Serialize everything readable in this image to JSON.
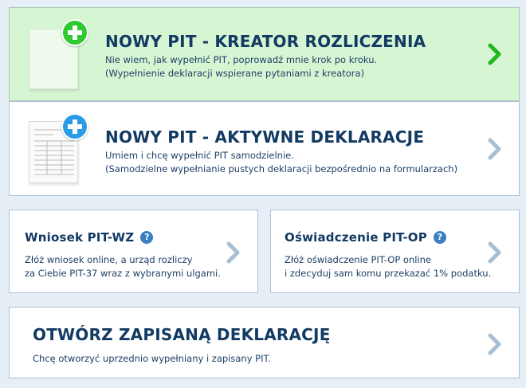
{
  "cards": {
    "kreator": {
      "title": "NOWY PIT - KREATOR ROZLICZENIA",
      "line1": "Nie wiem, jak wypełnić PIT, poprowadź mnie krok po kroku.",
      "line2": "(Wypełnienie deklaracji wspierane pytaniami z kreatora)",
      "icon": "blank-document-add-icon",
      "plus_color": "#2ecb2e",
      "background": "#d6f5d3",
      "chevron_color": "#1fb81f"
    },
    "aktywne": {
      "title": "NOWY PIT - AKTYWNE DEKLARACJE",
      "line1": "Umiem i chcę wypełnić PIT samodzielnie.",
      "line2": "(Samodzielne wypełnianie pustych deklaracji bezpośrednio na formularzach)",
      "icon": "form-document-add-icon",
      "plus_color": "#2a9be6",
      "chevron_color": "#a8bfd3"
    },
    "wniosek": {
      "title": "Wniosek PIT-WZ",
      "line1": "Złóż wniosek online, a urząd rozliczy",
      "line2": "za Ciebie PIT-37 wraz z wybranymi ulgami.",
      "help_icon": "help-question-icon",
      "help_glyph": "?"
    },
    "oswiadczenie": {
      "title": "Oświadczenie PIT-OP",
      "line1": "Złóż oświadczenie PIT-OP online",
      "line2": "i zdecyduj sam komu przekazać 1% podatku.",
      "help_icon": "help-question-icon",
      "help_glyph": "?"
    },
    "otworz": {
      "title": "OTWÓRZ ZAPISANĄ DEKLARACJĘ",
      "line1": "Chcę otworzyć uprzednio wypełniany i zapisany PIT."
    }
  },
  "colors": {
    "page_bg": "#e6eef6",
    "card_border": "#a9c2d8",
    "title_text": "#123a63",
    "chevron_grey": "#a8bfd3",
    "help_blue": "#3a7fc1"
  }
}
